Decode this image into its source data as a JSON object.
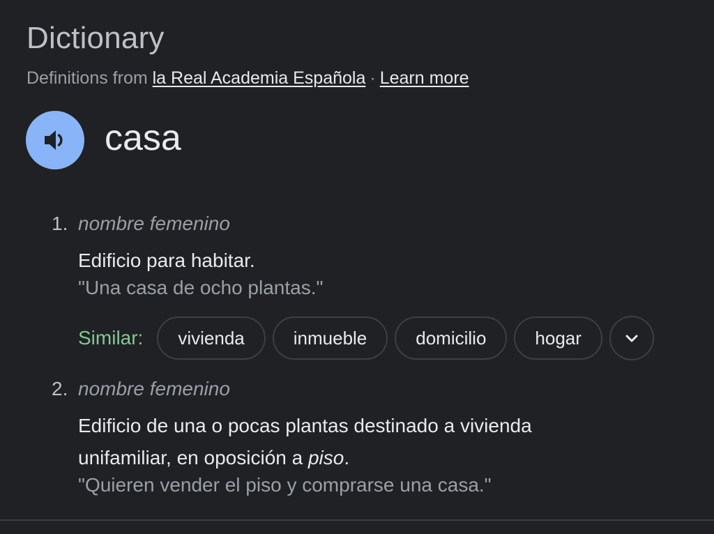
{
  "header": {
    "title": "Dictionary",
    "source_prefix": "Definitions from",
    "source_link": "la Real Academia Española",
    "separator": "·",
    "learn_more": "Learn more"
  },
  "entry": {
    "word": "casa",
    "speaker_icon": "speaker-icon"
  },
  "senses": [
    {
      "number": "1.",
      "pos": "nombre femenino",
      "definition": "Edificio para habitar.",
      "example": "\"Una casa de ocho plantas.\"",
      "similar_label": "Similar:",
      "similar": [
        "vivienda",
        "inmueble",
        "domicilio",
        "hogar"
      ],
      "more_icon": "chevron-down-icon"
    },
    {
      "number": "2.",
      "pos": "nombre femenino",
      "definition_part1": "Edificio de una o pocas plantas destinado a vivienda unifamiliar, en oposición a ",
      "definition_italic": "piso",
      "definition_end": ".",
      "example": "\"Quieren vender el piso y comprarse una casa.\""
    }
  ],
  "colors": {
    "background": "#202124",
    "accent_blue": "#8ab4f8",
    "similar_green": "#81c995"
  }
}
